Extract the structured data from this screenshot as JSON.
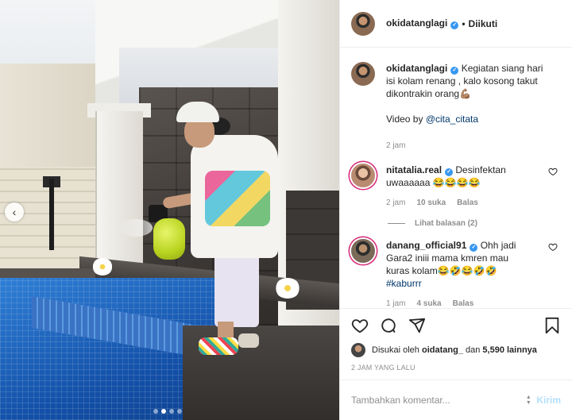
{
  "post": {
    "author": "okidatanglagi",
    "follow_status": "Diikuti",
    "separator": "•"
  },
  "caption": {
    "username": "okidatanglagi",
    "text_line1": "Kegiatan siang hari",
    "text_line2": "isi kolam renang , kalo kosong takut",
    "text_line3": "dikontrakin orang💪🏽",
    "video_prefix": "Video by ",
    "video_mention": "@cita_citata",
    "time": "2 jam"
  },
  "comments": [
    {
      "username": "nitatalia.real",
      "text_line1": "Desinfektan",
      "text_line2": "uwaaaaaa 😂😂😂😂",
      "time": "2 jam",
      "likes": "10 suka",
      "reply": "Balas",
      "view_replies": "Lihat balasan (2)"
    },
    {
      "username": "danang_official91",
      "text_line1": "Ohh jadi",
      "text_line2": "Gara2 iniii mama kmren mau",
      "text_line3": "kuras kolam😂🤣😂🤣🤣",
      "hashtag": "#kaburrr",
      "time": "1 jam",
      "likes": "4 suka",
      "reply": "Balas"
    }
  ],
  "likes": {
    "prefix": "Disukai oleh ",
    "liked_by": "oidatang_",
    "conjunction": " dan ",
    "others": "5,590 lainnya"
  },
  "time_ago": "2 JAM YANG LALU",
  "add_comment": {
    "placeholder": "Tambahkan komentar...",
    "send_label": "Kirim"
  },
  "carousel": {
    "prev_arrow": "‹",
    "slide_count": 4,
    "active_slide": 1
  },
  "icons": {
    "verified": "verified-badge-icon",
    "like": "heart-icon",
    "comment": "comment-icon",
    "share": "send-icon",
    "save": "bookmark-icon"
  }
}
